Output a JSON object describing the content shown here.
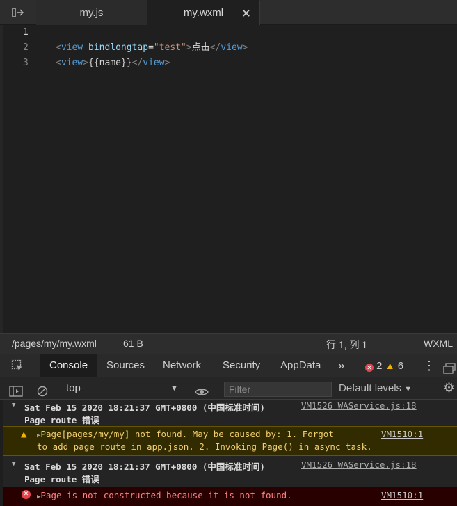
{
  "tabs": [
    {
      "label": "my.js"
    },
    {
      "label": "my.wxml"
    }
  ],
  "editor": {
    "lines": [
      {
        "num": "1"
      },
      {
        "num": "2",
        "open": "<",
        "tag": "view",
        "attr": "bindlongtap",
        "eq": "=",
        "value": "\"test\"",
        "close": ">",
        "text": "点击",
        "end_open": "</",
        "end_tag": "view",
        "end_close": ">"
      },
      {
        "num": "3",
        "open": "<",
        "tag": "view",
        "close": ">",
        "text": "{{name}}",
        "end_open": "</",
        "end_tag": "view",
        "end_close": ">"
      }
    ]
  },
  "status": {
    "path": "/pages/my/my.wxml",
    "size": "61 B",
    "position": "行 1, 列 1",
    "language": "WXML"
  },
  "devtools": {
    "tabs": [
      "Console",
      "Sources",
      "Network",
      "Security",
      "AppData"
    ],
    "more": "»",
    "error_count": "2",
    "warning_count": "6",
    "context": "top",
    "filter_placeholder": "Filter",
    "levels": "Default levels"
  },
  "console": {
    "group1": {
      "line1": "Sat Feb 15 2020 18:21:37 GMT+0800 (中国标准时间)",
      "line2": "Page route 错误",
      "source": "VM1526 WAService.js:18"
    },
    "warning": {
      "line1": "Page[pages/my/my] not found. May be caused by: 1. Forgot",
      "line2": "to add page route in app.json. 2. Invoking Page() in async task.",
      "source": "VM1510:1"
    },
    "group2": {
      "line1": "Sat Feb 15 2020 18:21:37 GMT+0800 (中国标准时间)",
      "line2": "Page route 错误",
      "source": "VM1526 WAService.js:18"
    },
    "error": {
      "line1": "Page is not constructed because it is not found.",
      "source": "VM1510:1"
    }
  }
}
